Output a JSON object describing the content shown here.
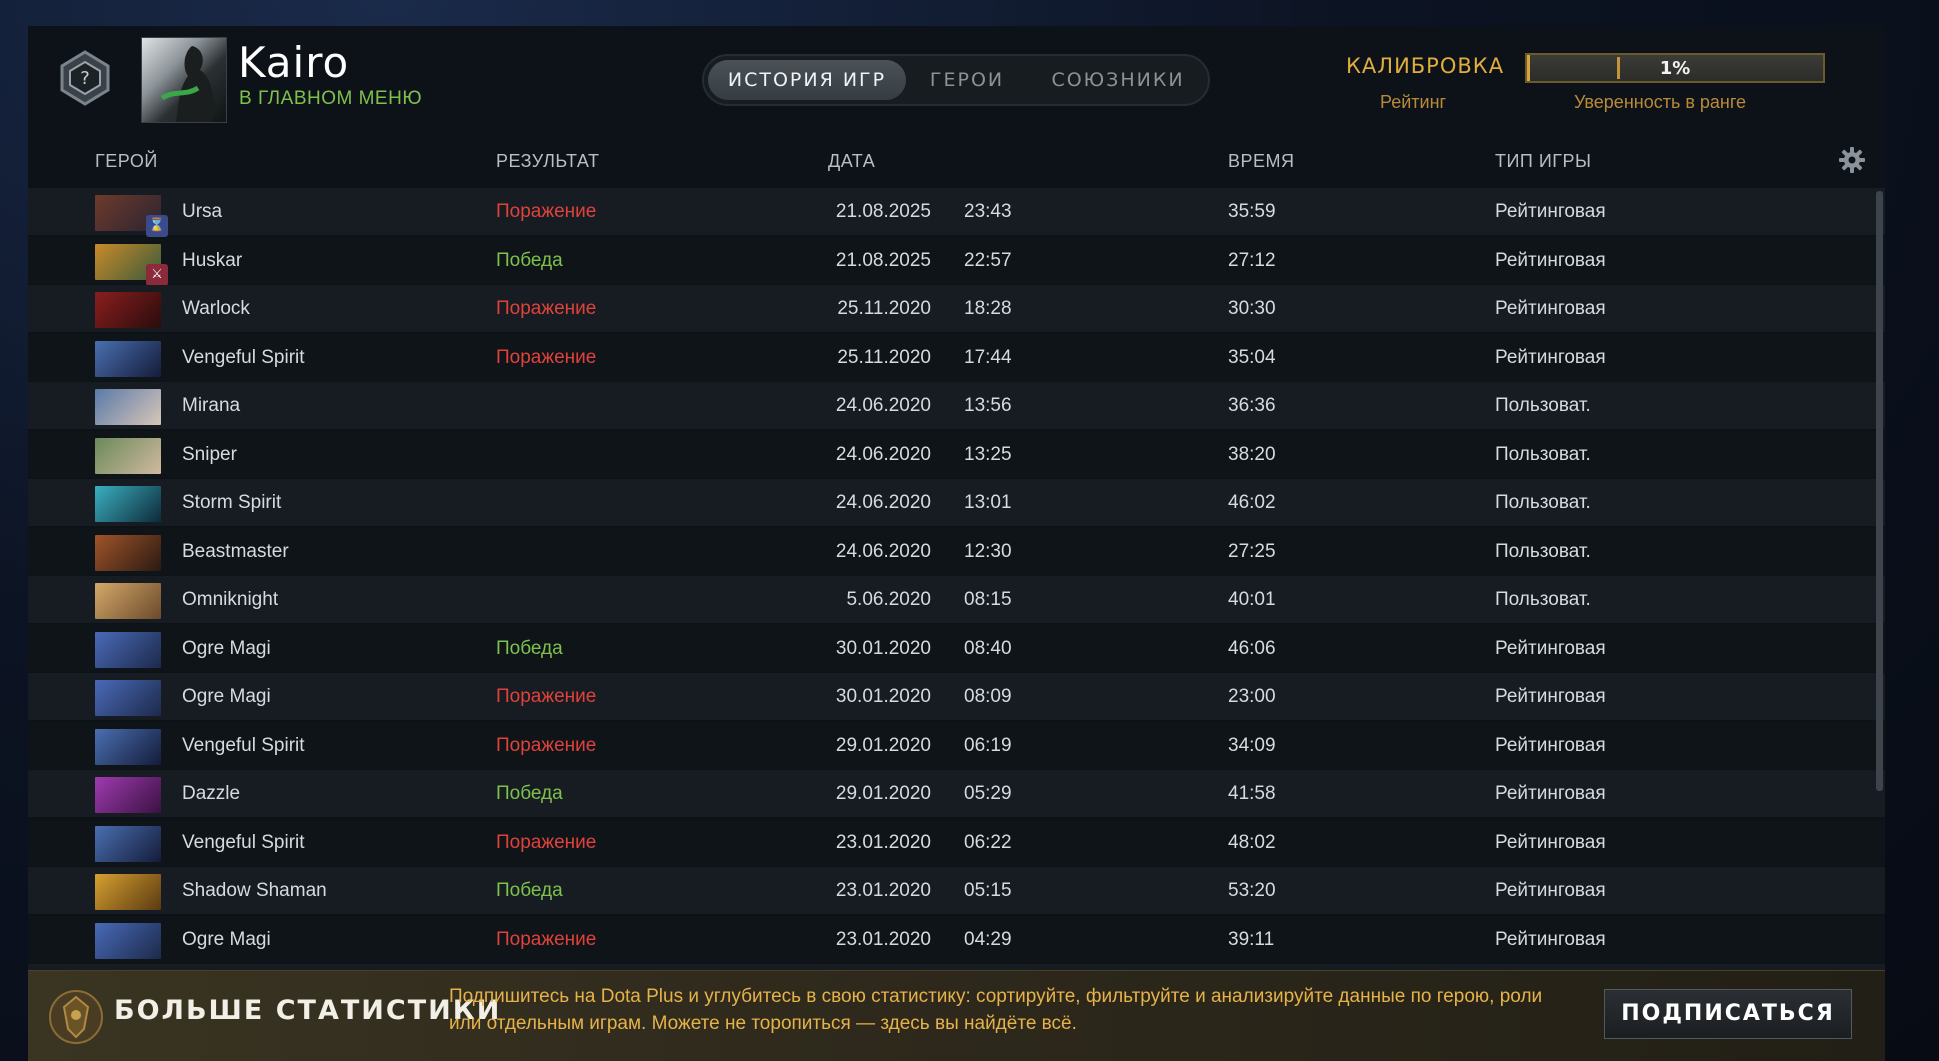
{
  "player": {
    "name": "Kairo",
    "status": "В ГЛАВНОМ МЕНЮ"
  },
  "tabs": [
    {
      "label": "ИСТОРИЯ ИГР",
      "active": true
    },
    {
      "label": "ГЕРОИ",
      "active": false
    },
    {
      "label": "СОЮЗНИКИ",
      "active": false
    }
  ],
  "calibration": {
    "title": "КАЛИБРОВКА",
    "rating_label": "Рейтинг",
    "confidence_value": "1%",
    "confidence_fraction": 0.01,
    "confidence_label": "Уверенность в ранге"
  },
  "columns": {
    "hero": "ГЕРОЙ",
    "result": "РЕЗУЛЬТАТ",
    "date": "ДАТА",
    "duration": "ВРЕМЯ",
    "type": "ТИП ИГРЫ"
  },
  "matches": [
    {
      "hero": "Ursa",
      "result": "Поражение",
      "outcome": "loss",
      "date": "21.08.2025",
      "time": "23:43",
      "duration": "35:59",
      "type": "Рейтинговая",
      "colors": [
        "#6e3a2c",
        "#2a2430"
      ],
      "badge": "hourglass-icon",
      "badge_glyph": "⌛"
    },
    {
      "hero": "Huskar",
      "result": "Победа",
      "outcome": "win",
      "date": "21.08.2025",
      "time": "22:57",
      "duration": "27:12",
      "type": "Рейтинговая",
      "colors": [
        "#c98a2a",
        "#3a5a3a"
      ],
      "badge": "sword-icon",
      "badge_glyph": "⚔"
    },
    {
      "hero": "Warlock",
      "result": "Поражение",
      "outcome": "loss",
      "date": "25.11.2020",
      "time": "18:28",
      "duration": "30:30",
      "type": "Рейтинговая",
      "colors": [
        "#8a1e1e",
        "#2a0c0c"
      ]
    },
    {
      "hero": "Vengeful Spirit",
      "result": "Поражение",
      "outcome": "loss",
      "date": "25.11.2020",
      "time": "17:44",
      "duration": "35:04",
      "type": "Рейтинговая",
      "colors": [
        "#4a6fb0",
        "#141c3a"
      ]
    },
    {
      "hero": "Mirana",
      "result": "",
      "outcome": "none",
      "date": "24.06.2020",
      "time": "13:56",
      "duration": "36:36",
      "type": "Пользоват.",
      "colors": [
        "#5a7aa8",
        "#d8c6b8"
      ]
    },
    {
      "hero": "Sniper",
      "result": "",
      "outcome": "none",
      "date": "24.06.2020",
      "time": "13:25",
      "duration": "38:20",
      "type": "Пользоват.",
      "colors": [
        "#6a8a5a",
        "#d0b9a0"
      ]
    },
    {
      "hero": "Storm Spirit",
      "result": "",
      "outcome": "none",
      "date": "24.06.2020",
      "time": "13:01",
      "duration": "46:02",
      "type": "Пользоват.",
      "colors": [
        "#3ab0c0",
        "#0e2a3a"
      ]
    },
    {
      "hero": "Beastmaster",
      "result": "",
      "outcome": "none",
      "date": "24.06.2020",
      "time": "12:30",
      "duration": "27:25",
      "type": "Пользоват.",
      "colors": [
        "#a0542a",
        "#2a1a12"
      ]
    },
    {
      "hero": "Omniknight",
      "result": "",
      "outcome": "none",
      "date": "5.06.2020",
      "time": "08:15",
      "duration": "40:01",
      "type": "Пользоват.",
      "colors": [
        "#d4a86a",
        "#6a4a2a"
      ]
    },
    {
      "hero": "Ogre Magi",
      "result": "Победа",
      "outcome": "win",
      "date": "30.01.2020",
      "time": "08:40",
      "duration": "46:06",
      "type": "Рейтинговая",
      "colors": [
        "#4a6ab8",
        "#1c2a4a"
      ]
    },
    {
      "hero": "Ogre Magi",
      "result": "Поражение",
      "outcome": "loss",
      "date": "30.01.2020",
      "time": "08:09",
      "duration": "23:00",
      "type": "Рейтинговая",
      "colors": [
        "#4a6ab8",
        "#1c2a4a"
      ]
    },
    {
      "hero": "Vengeful Spirit",
      "result": "Поражение",
      "outcome": "loss",
      "date": "29.01.2020",
      "time": "06:19",
      "duration": "34:09",
      "type": "Рейтинговая",
      "colors": [
        "#4a6fb0",
        "#141c3a"
      ]
    },
    {
      "hero": "Dazzle",
      "result": "Победа",
      "outcome": "win",
      "date": "29.01.2020",
      "time": "05:29",
      "duration": "41:58",
      "type": "Рейтинговая",
      "colors": [
        "#a03ab0",
        "#3a1242"
      ]
    },
    {
      "hero": "Vengeful Spirit",
      "result": "Поражение",
      "outcome": "loss",
      "date": "23.01.2020",
      "time": "06:22",
      "duration": "48:02",
      "type": "Рейтинговая",
      "colors": [
        "#4a6fb0",
        "#141c3a"
      ]
    },
    {
      "hero": "Shadow Shaman",
      "result": "Победа",
      "outcome": "win",
      "date": "23.01.2020",
      "time": "05:15",
      "duration": "53:20",
      "type": "Рейтинговая",
      "colors": [
        "#d6a030",
        "#5a3a12"
      ]
    },
    {
      "hero": "Ogre Magi",
      "result": "Поражение",
      "outcome": "loss",
      "date": "23.01.2020",
      "time": "04:29",
      "duration": "39:11",
      "type": "Рейтинговая",
      "colors": [
        "#4a6ab8",
        "#1c2a4a"
      ]
    },
    {
      "hero": "",
      "result": "",
      "outcome": "none",
      "date": "",
      "time": "",
      "duration": "",
      "type": "",
      "colors": [
        "#c9a070",
        "#3a2a1a"
      ]
    }
  ],
  "promo": {
    "title": "БОЛЬШЕ СТАТИСТИКИ",
    "text": "Подпишитесь на Dota Plus и углубитесь в свою статистику: сортируйте, фильтруйте и анализируйте данные по герою, роли или отдельным играм. Можете не торопиться — здесь вы найдёте всё.",
    "button": "ПОДПИСАТЬСЯ"
  },
  "colors": {
    "win": "#7ec14d",
    "loss": "#e0423b",
    "accent": "#e0ad3e"
  }
}
